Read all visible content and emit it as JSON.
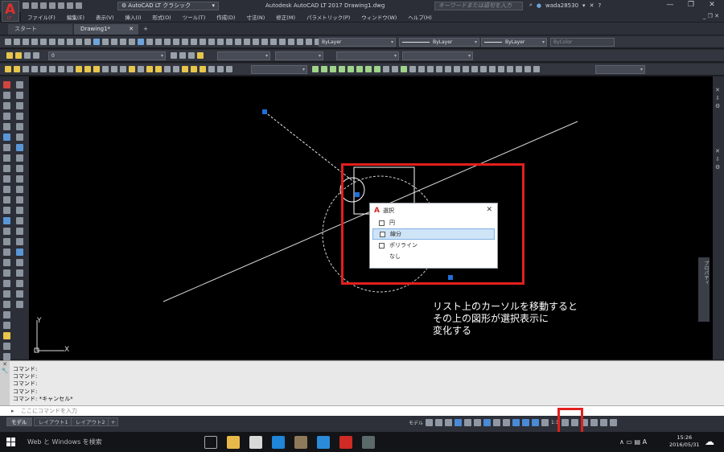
{
  "titlebar": {
    "workspace": "AutoCAD LT クラシック",
    "title": "Autodesk AutoCAD LT 2017   Drawing1.dwg",
    "search_placeholder": "キーワードまたは語句を入力",
    "user": "wada28530",
    "app_logo_letter": "A",
    "app_logo_sub": "LT"
  },
  "menu": [
    "ファイル(F)",
    "編集(E)",
    "表示(V)",
    "挿入(I)",
    "形式(O)",
    "ツール(T)",
    "作成(D)",
    "寸法(N)",
    "修正(M)",
    "パラメトリック(P)",
    "ウィンドウ(W)",
    "ヘルプ(H)"
  ],
  "tabs": {
    "start": "スタート",
    "drawing": "Drawing1*",
    "new": "+"
  },
  "toolbar": {
    "layer_value": "0",
    "color_value": "ByLayer",
    "linetype_value": "ByLayer",
    "lineweight_value": "ByLayer",
    "plotstyle_value": "ByColor"
  },
  "selection_popup": {
    "title": "選択",
    "items": [
      "円",
      "線分",
      "ポリライン",
      "なし"
    ],
    "highlighted_index": 1
  },
  "annotation": {
    "line1": "リスト上のカーソルを移動すると",
    "line2": "その上の図形が選択表示に",
    "line3": "変化する"
  },
  "ucs": {
    "x_label": "X",
    "y_label": "Y"
  },
  "command_history": [
    "コマンド:",
    "コマンド:",
    "コマンド:",
    "コマンド:",
    "コマンド:  *キャンセル*"
  ],
  "command_input": {
    "placeholder": "ここにコマンドを入力"
  },
  "layout_tabs": {
    "model": "モデル",
    "layout1": "レイアウト1",
    "layout2": "レイアウト2",
    "add": "+"
  },
  "status": {
    "model": "モデル",
    "scale": "1:1"
  },
  "properties_panel": {
    "label": "プロパティ"
  },
  "taskbar": {
    "search": "Web と Windows を検索",
    "time": "15:26",
    "date": "2016/05/31",
    "ime": "A"
  },
  "colors": {
    "highlight_red": "#e2201c",
    "selection_blue": "#cfe4f7",
    "grip_blue": "#1e6fd9",
    "autocad_red": "#d02a25"
  }
}
